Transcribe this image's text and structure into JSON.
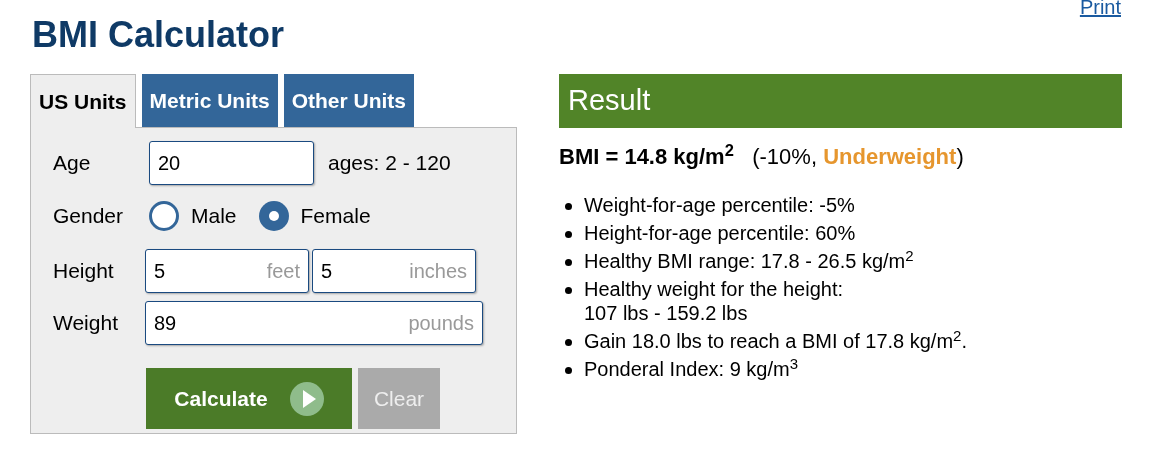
{
  "print_link": "Print",
  "title": "BMI Calculator",
  "tabs": [
    {
      "label": "US Units",
      "selected": true
    },
    {
      "label": "Metric Units",
      "selected": false
    },
    {
      "label": "Other Units",
      "selected": false
    }
  ],
  "form": {
    "age": {
      "label": "Age",
      "value": "20",
      "hint": "ages: 2 - 120"
    },
    "gender": {
      "label": "Gender",
      "options": [
        {
          "label": "Male",
          "selected": false
        },
        {
          "label": "Female",
          "selected": true
        }
      ]
    },
    "height": {
      "label": "Height",
      "fields": [
        {
          "value": "5",
          "unit": "feet"
        },
        {
          "value": "5",
          "unit": "inches"
        }
      ]
    },
    "weight": {
      "label": "Weight",
      "fields": [
        {
          "value": "89",
          "unit": "pounds"
        }
      ]
    },
    "buttons": [
      {
        "kind": "primary",
        "label": "Calculate"
      },
      {
        "kind": "secondary",
        "label": "Clear"
      }
    ]
  },
  "result": {
    "header": "Result",
    "bmi": "BMI = 14.8 kg/m$^{2}$",
    "change": "(-10%,",
    "category": "Underweight",
    "close": ")",
    "items": [
      {
        "lines": [
          "Weight-for-age percentile: -5%"
        ]
      },
      {
        "lines": [
          "Height-for-age percentile: 60%"
        ]
      },
      {
        "lines": [
          "Healthy BMI range: 17.8 - 26.5 kg/m$^{2}$"
        ]
      },
      {
        "lines": [
          "Healthy weight for the height:",
          "107 lbs - 159.2 lbs"
        ]
      },
      {
        "lines": [
          "Gain 18.0 lbs to reach a BMI of 17.8 kg/m$^{2}$."
        ]
      },
      {
        "lines": [
          "Ponderal Index: 9 kg/m$^{3}$"
        ]
      }
    ]
  }
}
